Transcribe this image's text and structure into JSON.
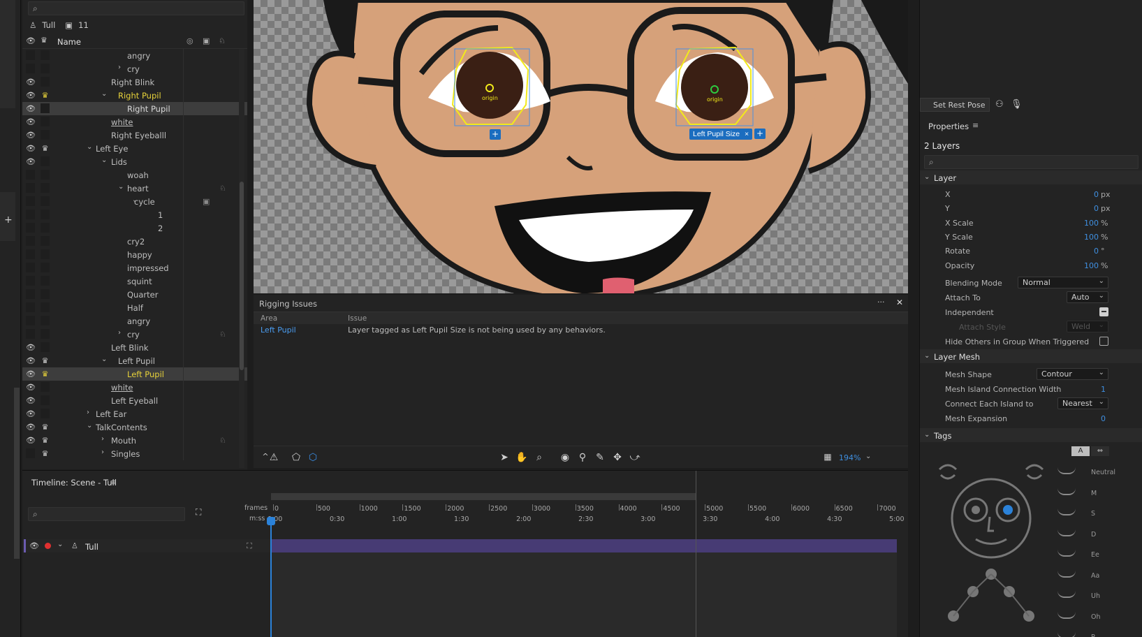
{
  "puppet_panel": {
    "puppet_name": "Tull",
    "frame_count": "11",
    "header_name": "Name",
    "layers": [
      {
        "name": "angry"
      },
      {
        "name": "cry"
      },
      {
        "name": "Right Blink"
      },
      {
        "name": "Right Pupil"
      },
      {
        "name": "Right Pupil"
      },
      {
        "name": "white"
      },
      {
        "name": "Right Eyeballl"
      },
      {
        "name": "Left Eye"
      },
      {
        "name": "Lids"
      },
      {
        "name": "woah"
      },
      {
        "name": "heart"
      },
      {
        "name": "cycle"
      },
      {
        "name": "1"
      },
      {
        "name": "2"
      },
      {
        "name": "cry2"
      },
      {
        "name": "happy"
      },
      {
        "name": "impressed"
      },
      {
        "name": "squint"
      },
      {
        "name": "Quarter"
      },
      {
        "name": "Half"
      },
      {
        "name": "angry"
      },
      {
        "name": "cry"
      },
      {
        "name": "Left Blink"
      },
      {
        "name": "Left Pupil"
      },
      {
        "name": "Left Pupil"
      },
      {
        "name": "white"
      },
      {
        "name": "Left Eyeball"
      },
      {
        "name": "Left Ear"
      },
      {
        "name": "TalkContents"
      },
      {
        "name": "Mouth"
      },
      {
        "name": "Singles"
      }
    ]
  },
  "canvas": {
    "origin_label": "origin",
    "tag_chip_label": "Left Pupil Size",
    "tag_chip_close": "×",
    "add_chip": "+"
  },
  "rigging": {
    "title": "Rigging Issues",
    "col_area": "Area",
    "col_issue": "Issue",
    "rows": [
      {
        "area": "Left Pupil",
        "issue": "Layer tagged as Left Pupil Size is not being used by any behaviors."
      }
    ],
    "more": "···",
    "close": "✕",
    "zoom": "194%"
  },
  "timeline": {
    "title": "Timeline: Scene - Tull",
    "frames_label": "frames",
    "mss_label": "m:ss",
    "frame_ticks": [
      "0",
      "500",
      "1000",
      "1500",
      "2000",
      "2500",
      "3000",
      "3500",
      "4000",
      "4500",
      "5000",
      "5500",
      "6000",
      "6500",
      "7000"
    ],
    "time_ticks": [
      "0:00",
      "0:30",
      "1:00",
      "1:30",
      "2:00",
      "2:30",
      "3:00",
      "3:30",
      "4:00",
      "4:30",
      "5:00"
    ],
    "track_name": "Tull"
  },
  "right_panel": {
    "set_rest_pose": "Set Rest Pose",
    "properties_title": "Properties",
    "selection_count": "2 Layers",
    "layer_section": "Layer",
    "props": [
      {
        "label": "X",
        "value": "0",
        "unit": "px"
      },
      {
        "label": "Y",
        "value": "0",
        "unit": "px"
      },
      {
        "label": "X Scale",
        "value": "100",
        "unit": "%"
      },
      {
        "label": "Y Scale",
        "value": "100",
        "unit": "%"
      },
      {
        "label": "Rotate",
        "value": "0",
        "unit": "°"
      },
      {
        "label": "Opacity",
        "value": "100",
        "unit": "%"
      }
    ],
    "blending_mode_label": "Blending Mode",
    "blending_mode_value": "Normal",
    "attach_to_label": "Attach To",
    "attach_to_value": "Auto",
    "independent_label": "Independent",
    "attach_style_label": "Attach Style",
    "attach_style_value": "Weld",
    "hide_others_label": "Hide Others in Group When Triggered",
    "layer_mesh_section": "Layer Mesh",
    "mesh_shape_label": "Mesh Shape",
    "mesh_shape_value": "Contour",
    "mesh_island_label": "Mesh Island Connection Width",
    "mesh_island_value": "1",
    "connect_label": "Connect Each Island to",
    "connect_value": "Nearest",
    "mesh_expansion_label": "Mesh Expansion",
    "mesh_expansion_value": "0",
    "tags_section": "Tags",
    "tag_toggle_a": "A",
    "mouth_tags": [
      "Neutral",
      "M",
      "S",
      "D",
      "Ee",
      "Aa",
      "Uh",
      "Oh",
      "R"
    ]
  }
}
